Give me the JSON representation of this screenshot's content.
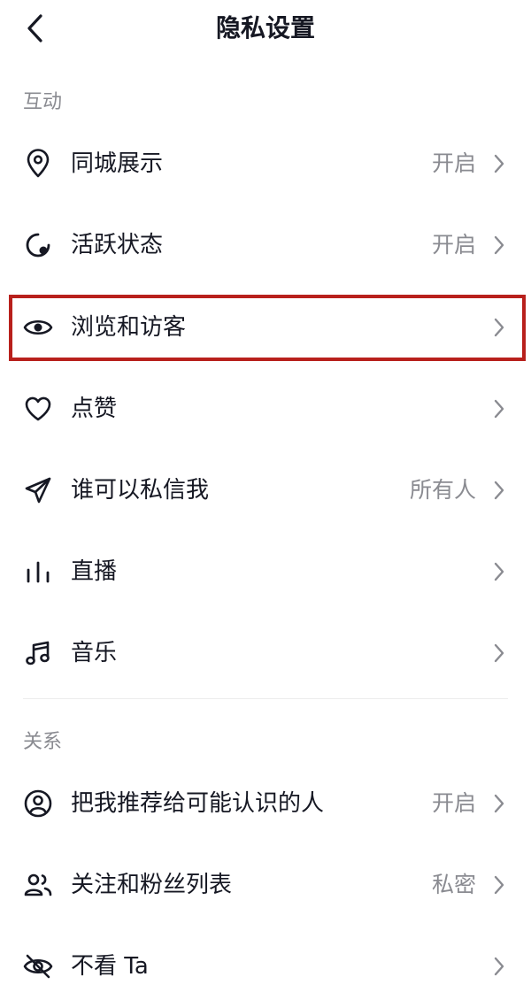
{
  "header": {
    "title": "隐私设置"
  },
  "sections": {
    "interaction": {
      "label": "互动"
    },
    "relations": {
      "label": "关系"
    }
  },
  "rows": {
    "city": {
      "label": "同城展示",
      "value": "开启",
      "icon": "location-pin-icon"
    },
    "active": {
      "label": "活跃状态",
      "value": "开启",
      "icon": "active-status-icon"
    },
    "visitors": {
      "label": "浏览和访客",
      "value": "",
      "icon": "eye-icon"
    },
    "likes": {
      "label": "点赞",
      "value": "",
      "icon": "heart-icon"
    },
    "messages": {
      "label": "谁可以私信我",
      "value": "所有人",
      "icon": "send-icon"
    },
    "live": {
      "label": "直播",
      "value": "",
      "icon": "live-bars-icon"
    },
    "music": {
      "label": "音乐",
      "value": "",
      "icon": "music-note-icon"
    },
    "recommend": {
      "label": "把我推荐给可能认识的人",
      "value": "开启",
      "icon": "user-circle-icon"
    },
    "follow": {
      "label": "关注和粉丝列表",
      "value": "私密",
      "icon": "users-icon"
    },
    "hide": {
      "label": "不看 Ta",
      "value": "",
      "icon": "eye-off-icon"
    }
  },
  "colors": {
    "text": "#161823",
    "secondary": "#8a8b91",
    "highlight_border": "#b8201c"
  }
}
